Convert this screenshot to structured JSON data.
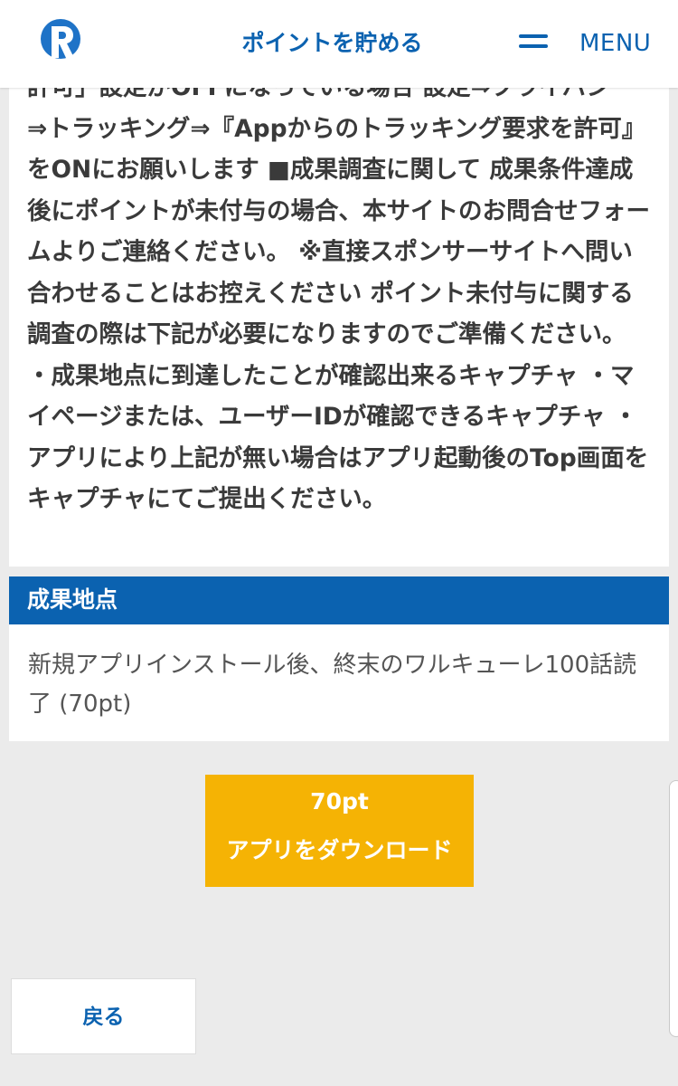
{
  "header": {
    "title": "ポイントを貯める",
    "menu_label": "MENU",
    "logo_icon": "r-logo-icon",
    "menu_icon": "hamburger-icon",
    "brand_color": "#0b62b0"
  },
  "description": {
    "text": "許可」設定がOFFになっている場合 設定⇒プライバシー⇒トラッキング⇒『Appからのトラッキング要求を許可』をONにお願いします ■成果調査に関して 成果条件達成後にポイントが未付与の場合、本サイトのお問合せフォームよりご連絡ください。 ※直接スポンサーサイトへ問い合わせることはお控えください ポイント未付与に関する調査の際は下記が必要になりますのでご準備ください。 ・成果地点に到達したことが確認出来るキャプチャ ・マイページまたは、ユーザーIDが確認できるキャプチャ ・アプリにより上記が無い場合はアプリ起動後のTop画面をキャプチャにてご提出ください。"
  },
  "section": {
    "title": "成果地点",
    "body": "新規アプリインストール後、終末のワルキューレ100話読了 (70pt)"
  },
  "cta": {
    "points": "70pt",
    "label": "アプリをダウンロード",
    "color": "#f5b304"
  },
  "back_button": {
    "label": "戻る"
  }
}
